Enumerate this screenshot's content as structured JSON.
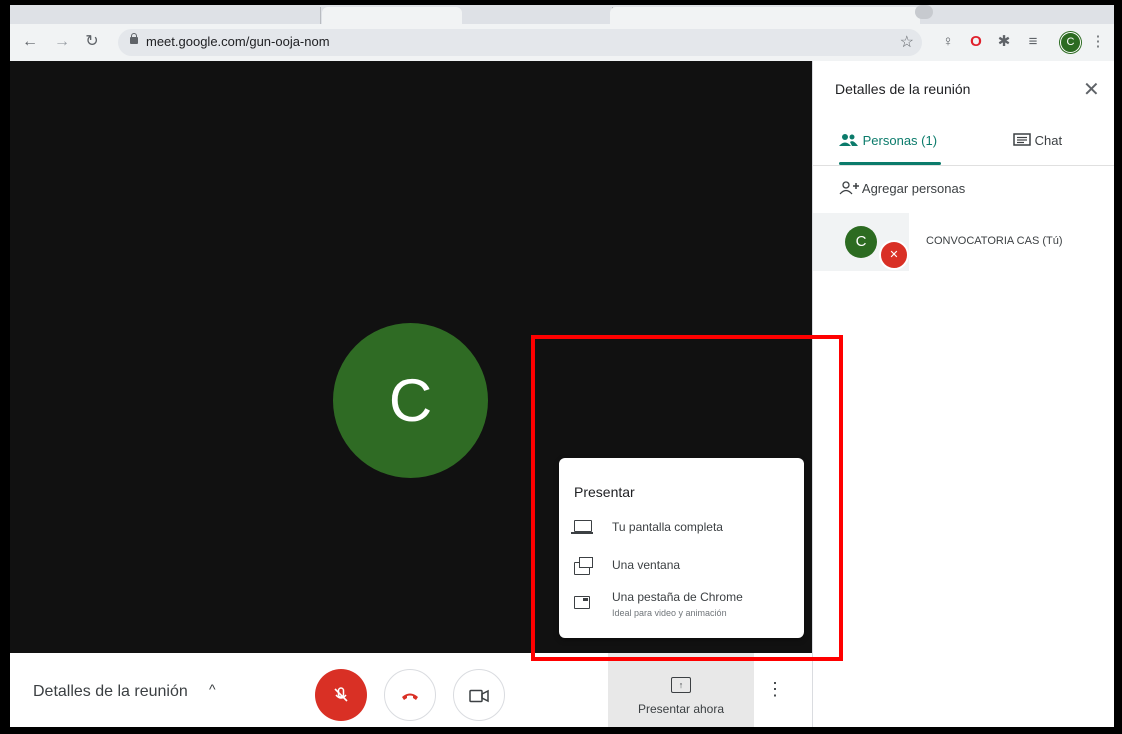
{
  "browser": {
    "url": "meet.google.com/gun-ooja-nom",
    "profile_initial": "C"
  },
  "stage": {
    "avatar_initial": "C"
  },
  "panel": {
    "title": "Detalles de la reunión",
    "tab_people": "Personas (1)",
    "tab_chat": "Chat",
    "add_people": "Agregar personas",
    "participant": {
      "initial": "C",
      "name": "CONVOCATORIA CAS (Tú)"
    }
  },
  "bottombar": {
    "meeting_details": "Detalles de la reunión",
    "present_now": "Presentar ahora"
  },
  "present_menu": {
    "title": "Presentar",
    "items": [
      {
        "label": "Tu pantalla completa",
        "icon": "laptop-icon"
      },
      {
        "label": "Una ventana",
        "icon": "window-icon"
      },
      {
        "label": "Una pestaña de Chrome",
        "sub": "Ideal para video y animación",
        "icon": "chrome-tab-icon"
      }
    ]
  },
  "colors": {
    "accent": "#0b7b6b",
    "avatar": "#2f6b24",
    "danger": "#d93025",
    "highlight": "#ff0000"
  }
}
